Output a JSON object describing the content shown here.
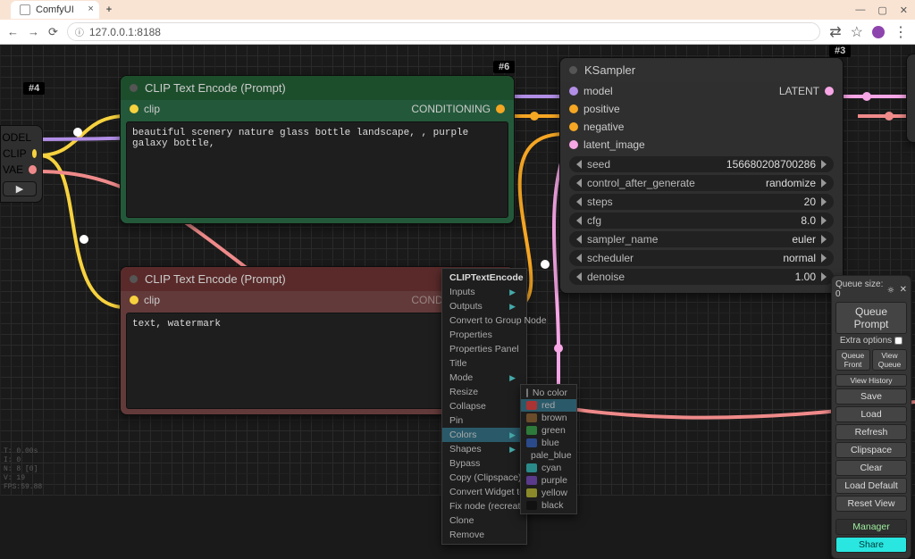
{
  "browser": {
    "tab_title": "ComfyUI",
    "url": "127.0.0.1:8188",
    "window_controls": {
      "min": "—",
      "max": "▢",
      "close": "✕"
    }
  },
  "badges": {
    "b3": "#3",
    "b4": "#4",
    "b6": "#6"
  },
  "frag": {
    "out0": "ODEL",
    "out1": "CLIP",
    "out2": "VAE",
    "play": "▶"
  },
  "node_green": {
    "title": "CLIP Text Encode (Prompt)",
    "in0": "clip",
    "out0": "CONDITIONING",
    "text": "beautiful scenery nature glass bottle landscape, , purple galaxy bottle,"
  },
  "node_red": {
    "title": "CLIP Text Encode (Prompt)",
    "in0": "clip",
    "out0": "CONDITIONING",
    "text": "text, watermark"
  },
  "node_k": {
    "title": "KSampler",
    "in": [
      "model",
      "positive",
      "negative",
      "latent_image"
    ],
    "out0": "LATENT",
    "widgets": [
      {
        "label": "seed",
        "value": "156680208700286"
      },
      {
        "label": "control_after_generate",
        "value": "randomize"
      },
      {
        "label": "steps",
        "value": "20"
      },
      {
        "label": "cfg",
        "value": "8.0"
      },
      {
        "label": "sampler_name",
        "value": "euler"
      },
      {
        "label": "scheduler",
        "value": "normal"
      },
      {
        "label": "denoise",
        "value": "1.00"
      }
    ]
  },
  "ctx": {
    "head": "CLIPTextEncode",
    "items": [
      "Inputs",
      "Outputs",
      "Convert to Group Node",
      "Properties",
      "Properties Panel",
      "Title",
      "Mode",
      "Resize",
      "Collapse",
      "Pin",
      "Colors",
      "Shapes",
      "Bypass",
      "Copy (Clipspace)",
      "Convert Widget to Input",
      "Fix node (recreate)",
      "Clone",
      "Remove"
    ],
    "arrow_idx": [
      0,
      1,
      6,
      10,
      11,
      14
    ],
    "hl_idx": 10
  },
  "color_sub": [
    {
      "label": "No color",
      "c": "#777"
    },
    {
      "label": "red",
      "c": "#a33"
    },
    {
      "label": "brown",
      "c": "#6b4c2a"
    },
    {
      "label": "green",
      "c": "#2d7a3a"
    },
    {
      "label": "blue",
      "c": "#2a4a8a"
    },
    {
      "label": "pale_blue",
      "c": "#3a6a8a"
    },
    {
      "label": "cyan",
      "c": "#2a8a8a"
    },
    {
      "label": "purple",
      "c": "#5a3a8a"
    },
    {
      "label": "yellow",
      "c": "#8a8a2a"
    },
    {
      "label": "black",
      "c": "#111"
    }
  ],
  "panel": {
    "queue_size": "Queue size: 0",
    "queue_prompt": "Queue Prompt",
    "extra_options": "Extra options",
    "queue_front": "Queue Front",
    "view_queue": "View Queue",
    "view_history": "View History",
    "save": "Save",
    "load": "Load",
    "refresh": "Refresh",
    "clipspace": "Clipspace",
    "clear": "Clear",
    "load_default": "Load Default",
    "reset_view": "Reset View",
    "manager": "Manager",
    "share": "Share"
  },
  "stats": [
    "T: 0.00s",
    "I: 0",
    "N: 8 [0]",
    "V: 19",
    "FPS:59.88"
  ]
}
